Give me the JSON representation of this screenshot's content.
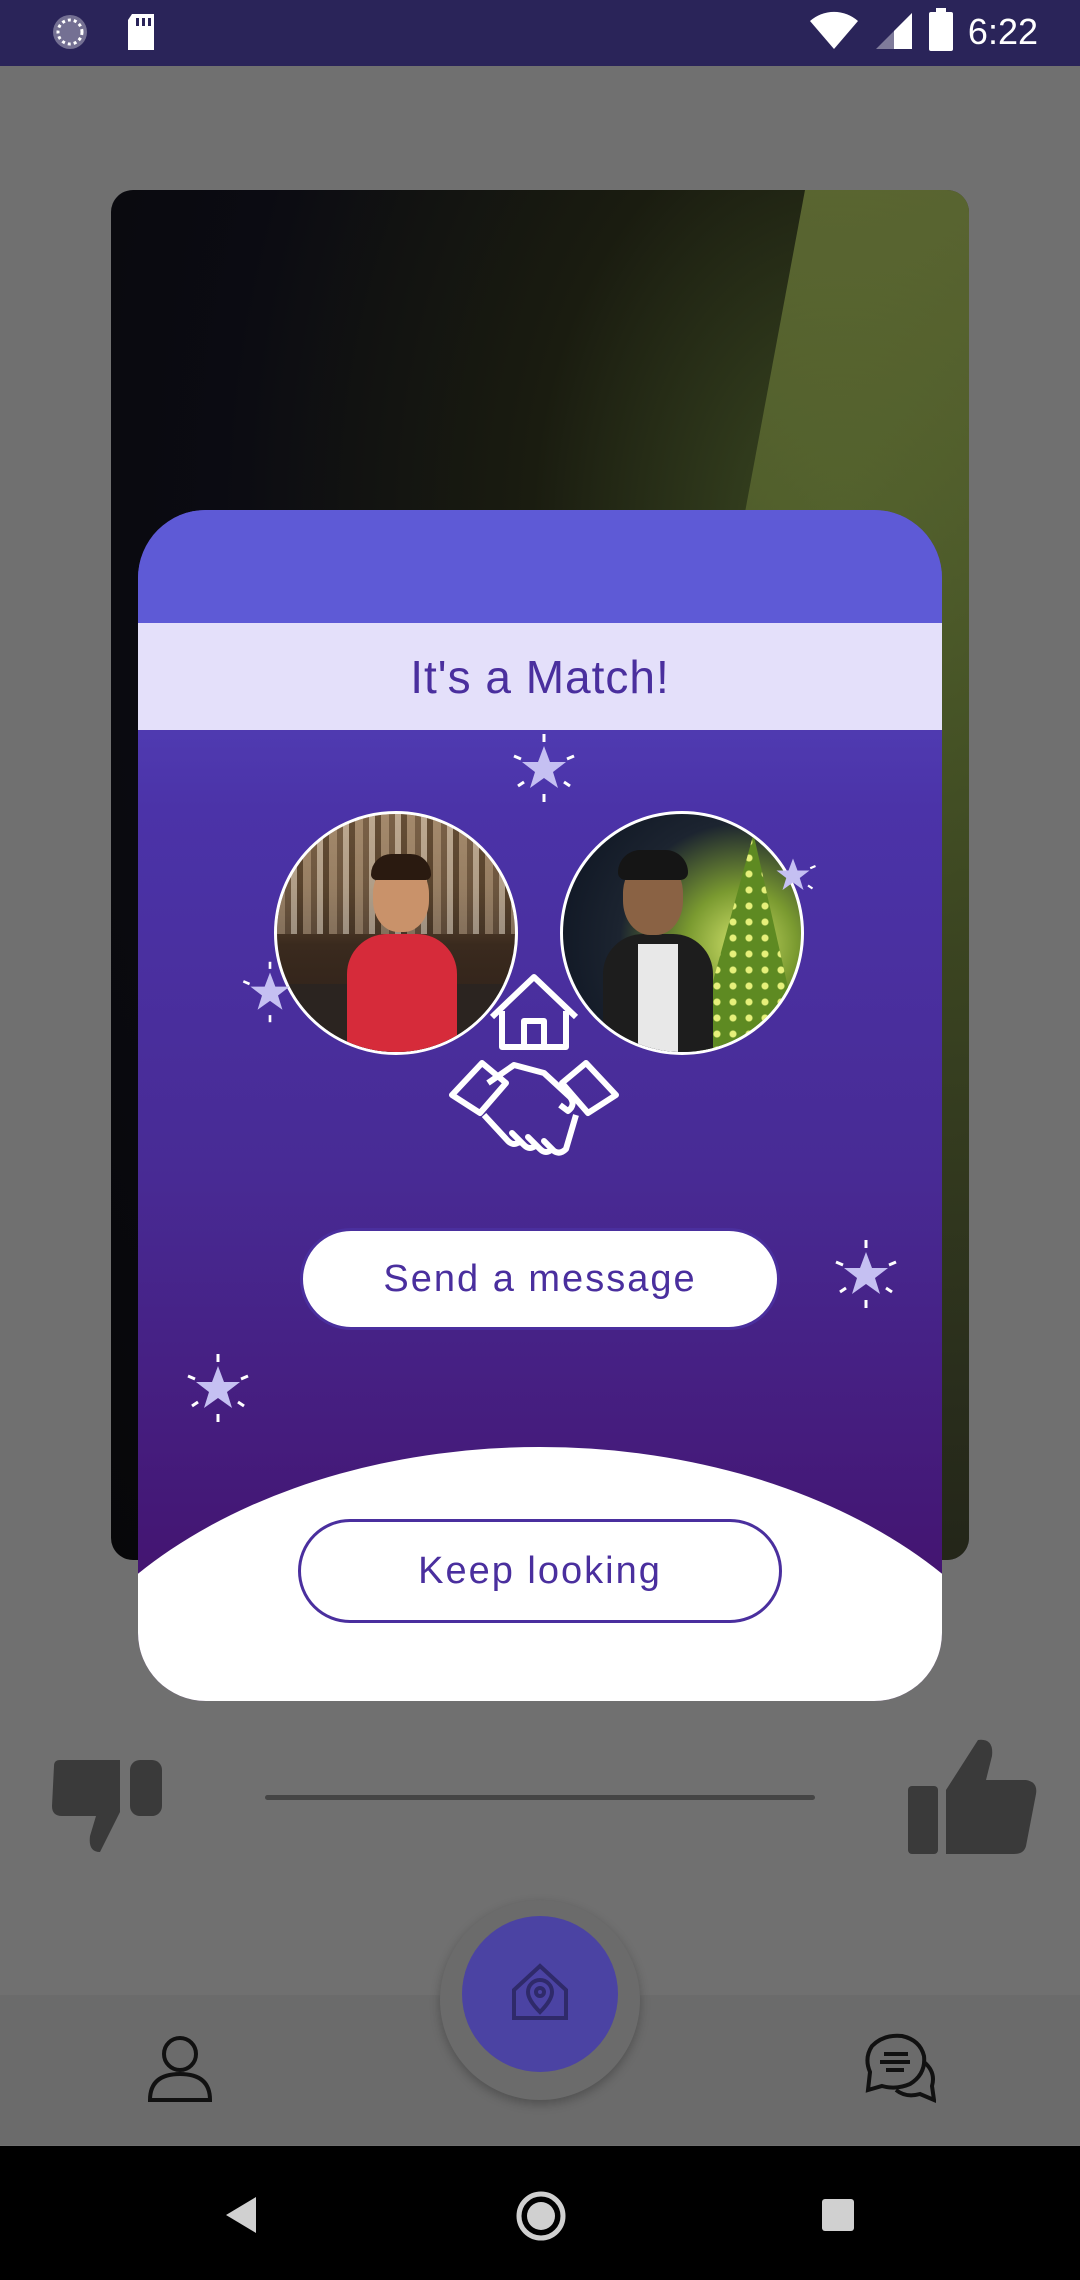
{
  "status_bar": {
    "time": "6:22",
    "icons": [
      "sync-icon",
      "sd-card-icon",
      "wifi-icon",
      "cell-signal-icon",
      "battery-icon"
    ]
  },
  "match_dialog": {
    "title": "It's a Match!",
    "send_message_label": "Send a message",
    "keep_looking_label": "Keep looking",
    "emblem_icon": "house-handshake-icon"
  },
  "reactions": {
    "dislike_icon": "thumbs-down-icon",
    "like_icon": "thumbs-up-icon"
  },
  "bottom_nav": {
    "items": [
      "profile-icon",
      "home-location-icon",
      "chat-icon"
    ]
  },
  "colors": {
    "accent": "#4a2f9e",
    "dialog_top": "#5e5ad6",
    "banner": "#e4e0fa",
    "status_bar": "#2a2459"
  }
}
